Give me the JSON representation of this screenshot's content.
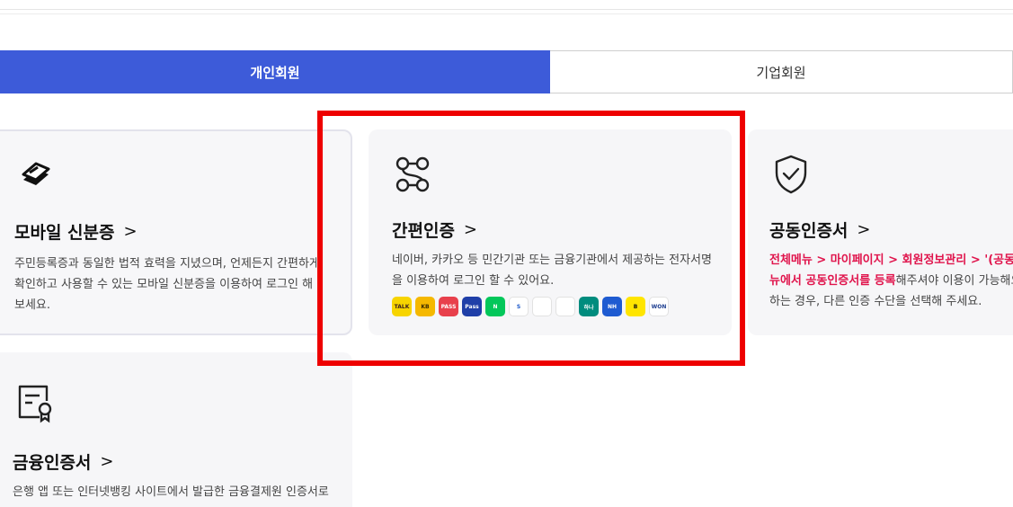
{
  "tabs": {
    "personal": "개인회원",
    "business": "기업회원"
  },
  "cards": {
    "mobile": {
      "title": "모바일 신분증",
      "chevron": ">",
      "desc": "주민등록증과 동일한 법적 효력을 지녔으며, 언제든지 간편하게 확인하고 사용할 수 있는 모바일 신분증을 이용하여 로그인 해 보세요."
    },
    "simple": {
      "title": "간편인증",
      "chevron": ">",
      "desc": "네이버, 카카오 등 민간기관 또는 금융기관에서 제공하는 전자서명을 이용하여 로그인 할 수 있어요."
    },
    "joint": {
      "title": "공동인증서",
      "chevron": ">",
      "desc_line1": "전체메뉴 > 마이페이지 > 회원정보관리 > '(공동) 인",
      "desc_line2_red": "뉴에서 공동인증서를 등록",
      "desc_line2_rest": "해주셔야 이용이 가능해요",
      "desc_line3": "하는 경우, 다른 인증 수단을 선택해 주세요."
    },
    "finance": {
      "title": "금융인증서",
      "chevron": ">",
      "desc": "은행 앱 또는 인터넷뱅킹 사이트에서 발급한 금융결제원 인증서로"
    }
  },
  "providers": [
    {
      "name": "kakao",
      "label": "TALK",
      "color": "#f7d400",
      "text": "#3a1d1d"
    },
    {
      "name": "kb",
      "label": "KB",
      "color": "#f5b800",
      "text": "#3a2a00"
    },
    {
      "name": "pass",
      "label": "PASS",
      "color": "#e8404c",
      "text": "#ffffff"
    },
    {
      "name": "samsung-pass",
      "label": "Pass",
      "color": "#1f3fa8",
      "text": "#ffffff"
    },
    {
      "name": "naver",
      "label": "N",
      "color": "#03c75a",
      "text": "#ffffff"
    },
    {
      "name": "shinhan",
      "label": "S",
      "color": "#ffffff",
      "text": "#1a57c9"
    },
    {
      "name": "toss",
      "label": "",
      "color": "#ffffff",
      "text": "#0064ff"
    },
    {
      "name": "banksalad",
      "label": "",
      "color": "#ffffff",
      "text": "#1cc1a0"
    },
    {
      "name": "hana",
      "label": "하나",
      "color": "#008c7e",
      "text": "#ffffff"
    },
    {
      "name": "nh",
      "label": "NH",
      "color": "#1e5bd1",
      "text": "#ffffff"
    },
    {
      "name": "kbank",
      "label": "B",
      "color": "#ffe500",
      "text": "#111111"
    },
    {
      "name": "woori",
      "label": "WON",
      "color": "#ffffff",
      "text": "#1b3c8f"
    }
  ],
  "colors": {
    "tab_active": "#3d5bd9",
    "highlight": "#ee0000",
    "red_text": "#e0144c"
  }
}
